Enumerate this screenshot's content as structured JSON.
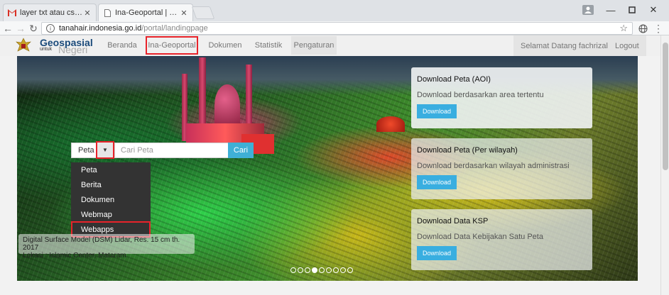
{
  "browser": {
    "tabs": [
      {
        "title": "layer txt atau csv - wiwik",
        "icon": "gmail-icon"
      },
      {
        "title": "Ina-Geoportal | Geospas",
        "icon": "page-icon"
      }
    ],
    "url_domain": "tanahair.indonesia.go.id",
    "url_path": "/portal/landingpage"
  },
  "site": {
    "logo_title": "Geospasial",
    "logo_small": "untuk",
    "logo_sub": "Negeri",
    "nav": [
      "Beranda",
      "Ina-Geoportal",
      "Dokumen",
      "Statistik",
      "Pengaturan"
    ],
    "active_nav": "Ina-Geoportal",
    "welcome": "Selamat Datang fachrizal",
    "logout": "Logout"
  },
  "search": {
    "selected": "Peta",
    "placeholder": "Cari Peta",
    "button": "Cari",
    "options": [
      "Peta",
      "Berita",
      "Dokumen",
      "Webmap",
      "Webapps"
    ],
    "highlighted": "Webapps"
  },
  "caption": {
    "line1": "Digital Surface Model (DSM) Lidar, Res. 15 cm th. 2017",
    "line2": "Lokasi : Islamic Center, Mataram"
  },
  "panels": [
    {
      "title": "Download Peta (AOI)",
      "desc": "Download berdasarkan area tertentu",
      "button": "Download"
    },
    {
      "title": "Download Peta (Per wilayah)",
      "desc": "Download berdasarkan wilayah administrasi",
      "button": "Download"
    },
    {
      "title": "Download Data KSP",
      "desc": "Download Data Kebijakan Satu Peta",
      "button": "Download"
    }
  ],
  "carousel": {
    "count": 9,
    "active": 3
  },
  "colors": {
    "highlight": "#e8232a",
    "accent": "#39aee0"
  }
}
